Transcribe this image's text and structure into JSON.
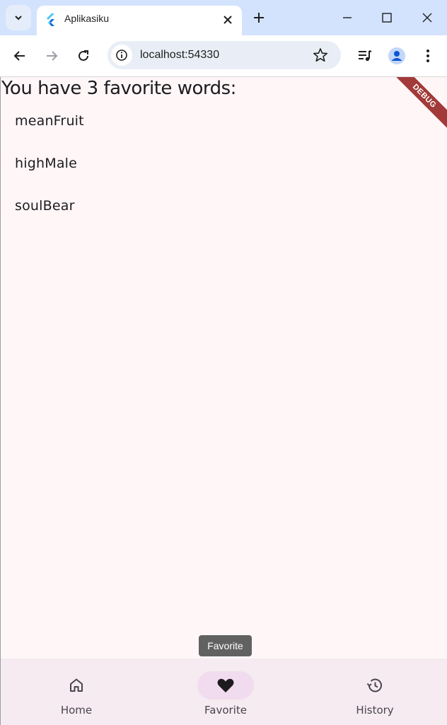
{
  "browser": {
    "tab_title": "Aplikasiku",
    "url": "localhost:54330"
  },
  "app": {
    "heading": "You have 3 favorite words:",
    "favorites": [
      "meanFruit",
      "highMale",
      "soulBear"
    ],
    "debug_banner": "DEBUG",
    "tooltip": "Favorite",
    "nav": {
      "home_label": "Home",
      "favorite_label": "Favorite",
      "history_label": "History",
      "selected": "Favorite"
    }
  },
  "colors": {
    "titlebar": "#d3e3fd",
    "page_background": "#fef6f7",
    "nav_background": "#f5ebf0",
    "active_indicator": "#f1dcef",
    "debug_ribbon": "#a13a38"
  },
  "icons": {
    "tab_search": "chevron-down-icon",
    "favicon": "flutter-icon",
    "home": "home-icon",
    "favorite": "heart-icon",
    "history": "history-icon"
  }
}
